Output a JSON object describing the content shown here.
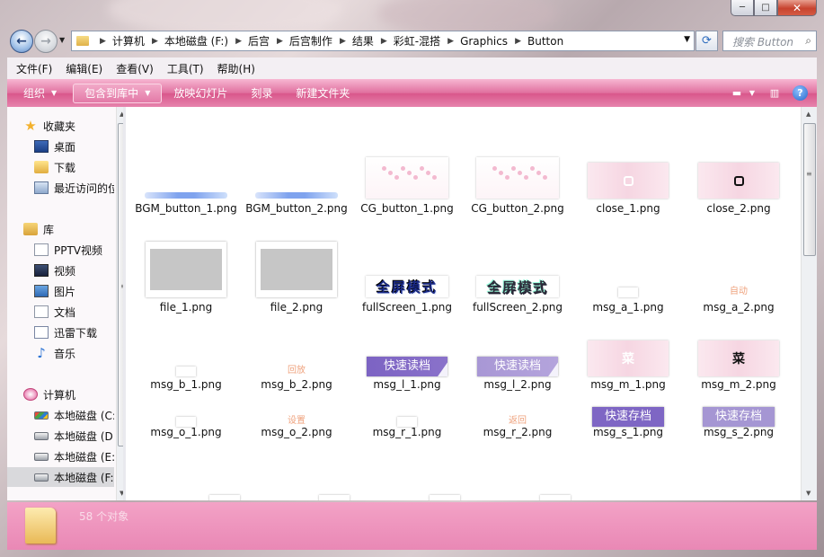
{
  "window": {
    "caption_buttons": {
      "minimize": "─",
      "maximize": "□",
      "close": "✕"
    }
  },
  "address": {
    "crumbs": [
      "计算机",
      "本地磁盘 (F:)",
      "后宫",
      "后宫制作",
      "结果",
      "彩虹-混搭",
      "Graphics",
      "Button"
    ],
    "search_placeholder": "搜索 Button"
  },
  "menu": [
    "文件(F)",
    "编辑(E)",
    "查看(V)",
    "工具(T)",
    "帮助(H)"
  ],
  "commands": {
    "organize": "组织",
    "include_library": "包含到库中",
    "slideshow": "放映幻灯片",
    "burn": "刻录",
    "new_folder": "新建文件夹"
  },
  "sidebar": {
    "favorites": {
      "label": "收藏夹",
      "items": [
        "桌面",
        "下载",
        "最近访问的位置"
      ]
    },
    "libraries": {
      "label": "库",
      "items": [
        "PPTV视频",
        "视频",
        "图片",
        "文档",
        "迅雷下载",
        "音乐"
      ]
    },
    "computer": {
      "label": "计算机",
      "drives": [
        "本地磁盘 (C:)",
        "本地磁盘 (D:)",
        "本地磁盘 (E:)",
        "本地磁盘 (F:)"
      ]
    }
  },
  "files": [
    {
      "name": "BGM_button_1.png",
      "thumb": "bgm"
    },
    {
      "name": "BGM_button_2.png",
      "thumb": "bgm"
    },
    {
      "name": "CG_button_1.png",
      "thumb": "cg"
    },
    {
      "name": "CG_button_2.png",
      "thumb": "cg"
    },
    {
      "name": "close_1.png",
      "thumb": "close-light"
    },
    {
      "name": "close_2.png",
      "thumb": "close-dark"
    },
    {
      "name": "file_1.png",
      "thumb": "file"
    },
    {
      "name": "file_2.png",
      "thumb": "file"
    },
    {
      "name": "fullScreen_1.png",
      "thumb": "fullscreen",
      "thumb_text": "全屏模式"
    },
    {
      "name": "fullScreen_2.png",
      "thumb": "fullscreen2",
      "thumb_text": "全屏模式"
    },
    {
      "name": "msg_a_1.png",
      "thumb": "small"
    },
    {
      "name": "msg_a_2.png",
      "thumb": "small-text",
      "thumb_text": "自动"
    },
    {
      "name": "msg_b_1.png",
      "thumb": "small"
    },
    {
      "name": "msg_b_2.png",
      "thumb": "small-text",
      "thumb_text": "回放"
    },
    {
      "name": "msg_l_1.png",
      "thumb": "purple",
      "thumb_text": "快速读档"
    },
    {
      "name": "msg_l_2.png",
      "thumb": "purple-light",
      "thumb_text": "快速读档"
    },
    {
      "name": "msg_m_1.png",
      "thumb": "mm-light",
      "thumb_text": "菜"
    },
    {
      "name": "msg_m_2.png",
      "thumb": "mm-dark",
      "thumb_text": "菜"
    },
    {
      "name": "msg_o_1.png",
      "thumb": "small"
    },
    {
      "name": "msg_o_2.png",
      "thumb": "small-text",
      "thumb_text": "设置"
    },
    {
      "name": "msg_r_1.png",
      "thumb": "small"
    },
    {
      "name": "msg_r_2.png",
      "thumb": "small-text",
      "thumb_text": "返回"
    },
    {
      "name": "msg_s_1.png",
      "thumb": "saves",
      "thumb_text": "快速存档"
    },
    {
      "name": "msg_s_2.png",
      "thumb": "saves-light",
      "thumb_text": "快速存档"
    }
  ],
  "status": {
    "count": "58 个对象"
  },
  "colors": {
    "command_bar": "#e06f9e",
    "status_bar": "#ee93bd",
    "selected_drive": "#d9d9dc"
  }
}
